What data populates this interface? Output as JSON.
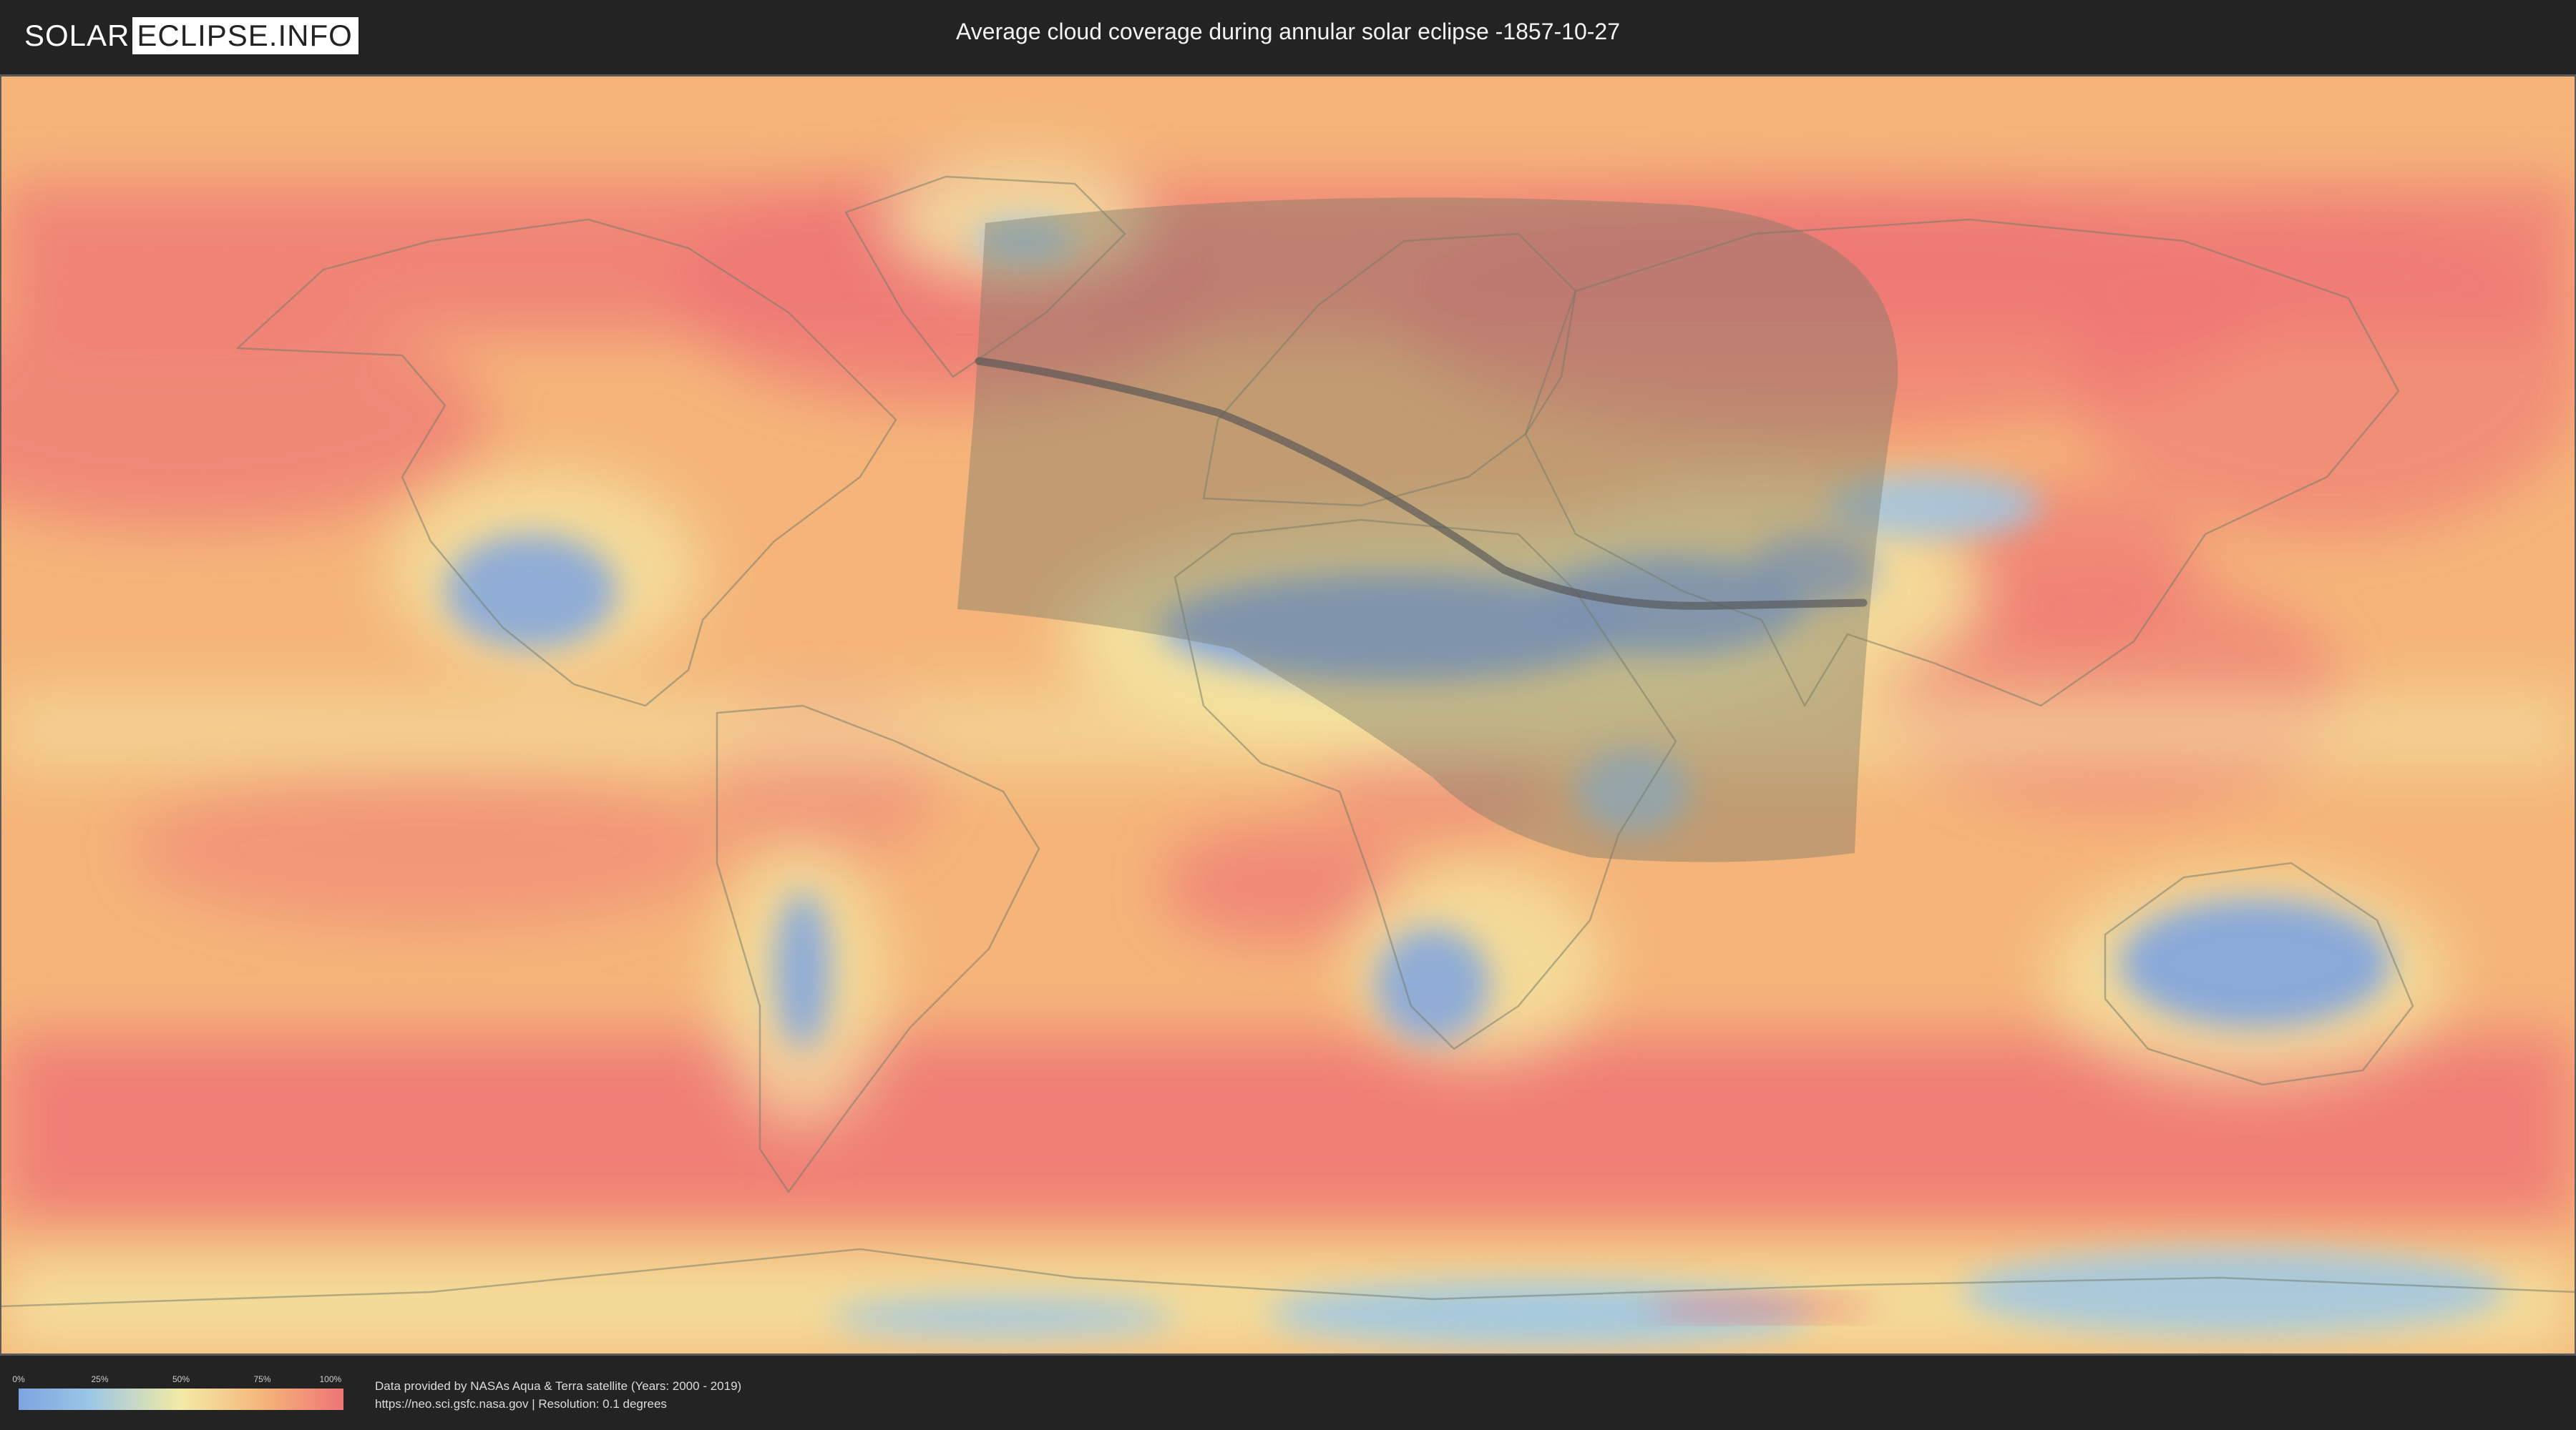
{
  "header": {
    "logo_left": "SOLAR",
    "logo_right": "ECLIPSE.INFO",
    "title": "Average cloud coverage during annular solar eclipse -1857-10-27"
  },
  "legend": {
    "ticks": [
      "0%",
      "25%",
      "50%",
      "75%",
      "100%"
    ],
    "colors": [
      "#7ea4e0",
      "#9cc6e6",
      "#f3eaa5",
      "#f5b57a",
      "#ee7575"
    ]
  },
  "footer": {
    "credit_line1": "Data provided by NASAs Aqua & Terra satellite (Years: 2000 - 2019)",
    "credit_line2": "https://neo.sci.gsfc.nasa.gov | Resolution: 0.1 degrees"
  },
  "map": {
    "projection": "equirectangular",
    "colors": {
      "high_cloud": "#ee7575",
      "mid_cloud": "#f5b57a",
      "low_mid_cloud": "#f3eaa5",
      "low_cloud": "#9cc6e6",
      "clear": "#7ea4e0",
      "eclipse_shade": "#7a7a6a",
      "central_line": "#555555"
    }
  }
}
